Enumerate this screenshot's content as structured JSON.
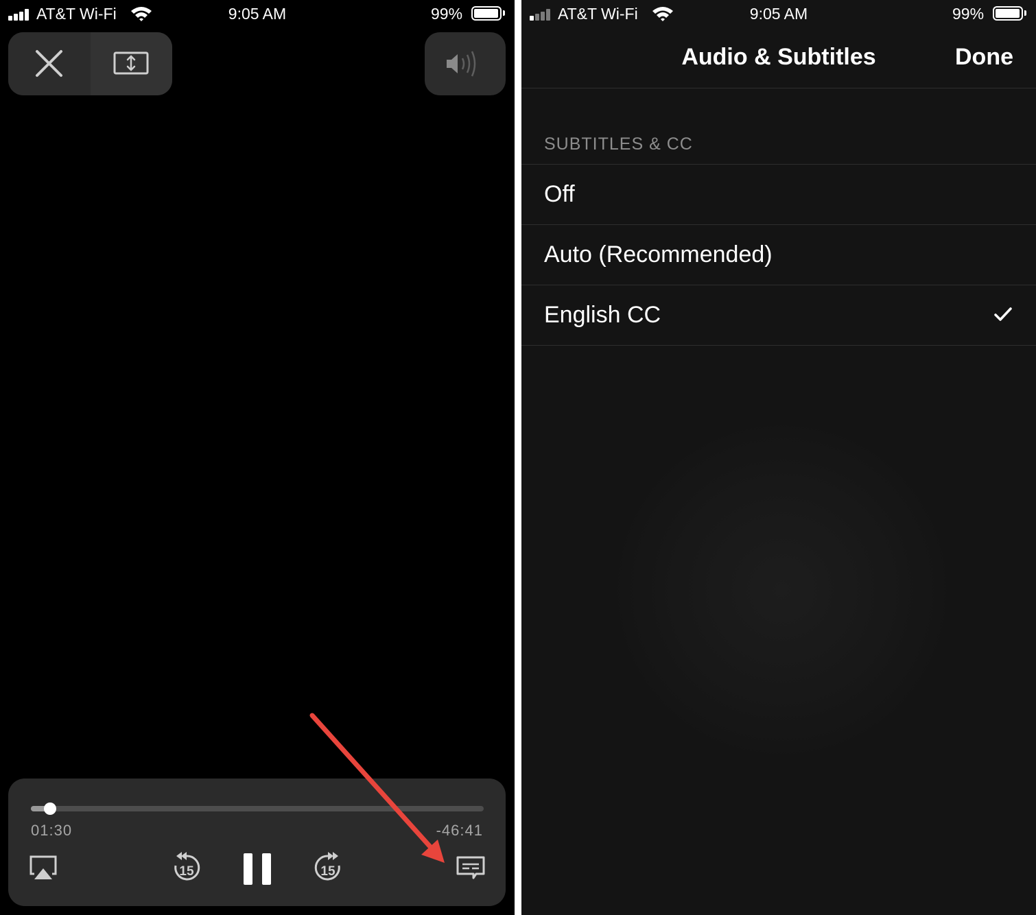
{
  "status_bar": {
    "carrier": "AT&T Wi-Fi",
    "time": "9:05 AM",
    "battery": "99%"
  },
  "player": {
    "top_controls": [
      "close-icon",
      "aspect-ratio-icon",
      "volume-icon"
    ],
    "elapsed": "01:30",
    "remaining": "-46:41",
    "progress_fraction": 0.043,
    "bottom_controls": [
      "airplay-icon",
      "skip-back-15-icon",
      "pause-icon",
      "skip-forward-15-icon",
      "subtitles-icon"
    ],
    "skip_back_label": "15",
    "skip_forward_label": "15",
    "annotation_arrow_color": "#e8453c"
  },
  "subtitles_screen": {
    "title": "Audio & Subtitles",
    "done_label": "Done",
    "section_header": "SUBTITLES & CC",
    "options": [
      {
        "label": "Off",
        "selected": false
      },
      {
        "label": "Auto (Recommended)",
        "selected": false
      },
      {
        "label": "English CC",
        "selected": true
      }
    ]
  },
  "colors": {
    "player_bg": "#000000",
    "panel_bg": "#2b2b2b",
    "sheet_bg": "#141414",
    "separator": "#2e2e2e",
    "secondary_text": "#8d8d8d"
  }
}
